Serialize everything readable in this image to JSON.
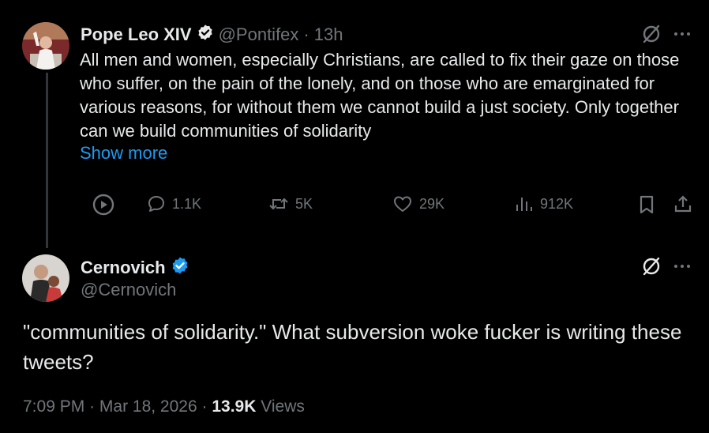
{
  "original_tweet": {
    "author_name": "Pope Leo XIV",
    "handle": "@Pontifex",
    "separator": "·",
    "time_ago": "13h",
    "text": "All men and women, especially Christians, are called to fix their gaze on those who suffer, on the pain of the lonely, and on those who are emarginated for various reasons, for without them we cannot build a just society. Only together can we build communities of solidarity",
    "show_more": "Show more",
    "actions": {
      "replies": "1.1K",
      "reposts": "5K",
      "likes": "29K",
      "views": "912K"
    },
    "verified_color": "#1d9bf0"
  },
  "reply_tweet": {
    "author_name": "Cernovich",
    "handle": "@Cernovich",
    "text": "\"communities of solidarity.\" What subversion woke fucker is writing these tweets?",
    "meta": {
      "time": "7:09 PM",
      "separator1": "·",
      "date": "Mar 18, 2026",
      "separator2": "·",
      "views_count": "13.9K",
      "views_label": "Views"
    },
    "verified_color": "#1d9bf0"
  },
  "colors": {
    "background": "#000000",
    "text_primary": "#e7e9ea",
    "text_secondary": "#71767b",
    "accent": "#1d9bf0"
  },
  "icons": [
    "grok-icon",
    "more-icon",
    "play-icon",
    "reply-icon",
    "repost-icon",
    "like-icon",
    "views-icon",
    "bookmark-icon",
    "share-icon",
    "verified-badge-icon"
  ]
}
